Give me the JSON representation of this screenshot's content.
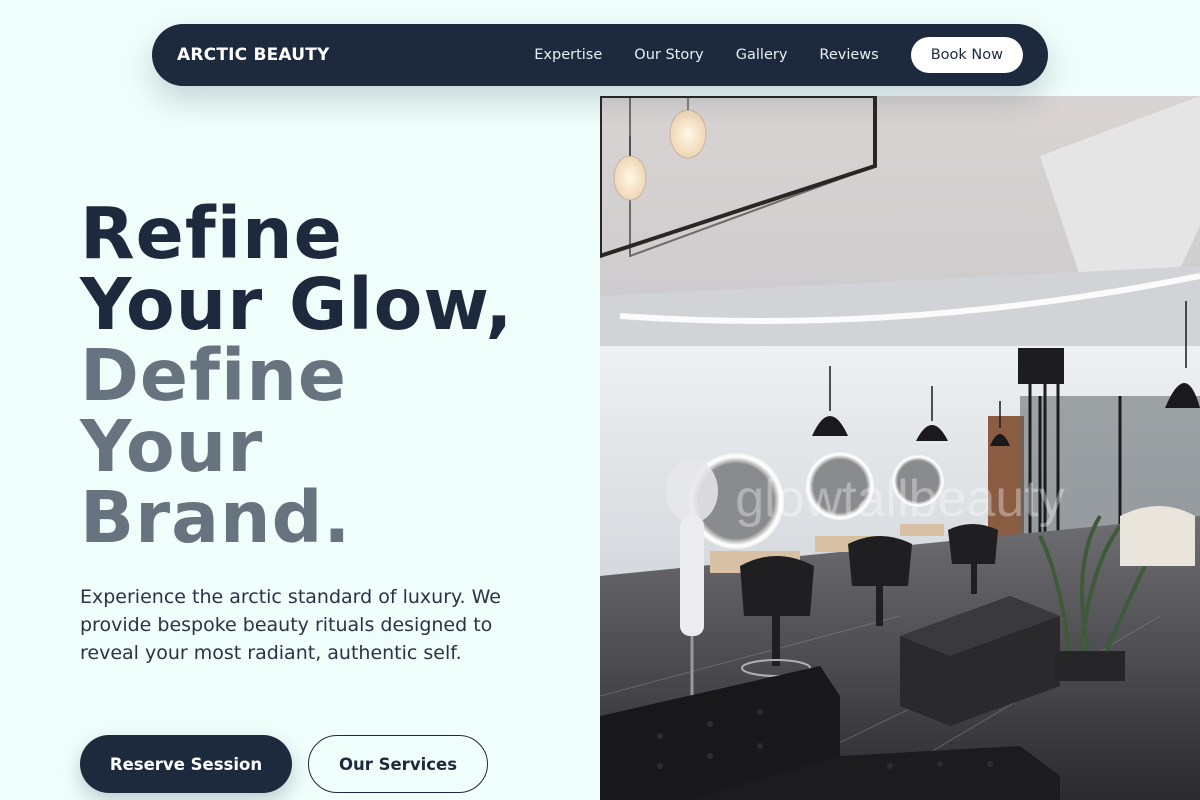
{
  "brand": "ARCTIC BEAUTY",
  "nav": {
    "links": [
      "Expertise",
      "Our Story",
      "Gallery",
      "Reviews"
    ],
    "cta": "Book Now"
  },
  "hero": {
    "title_lines_dark": [
      "Refine",
      "Your Glow,"
    ],
    "title_lines_muted": [
      "Define",
      "Your",
      "Brand."
    ],
    "subtitle": "Experience the arctic standard of luxury. We provide bespoke beauty rituals designed to reveal your most radiant, authentic self.",
    "primary_button": "Reserve Session",
    "secondary_button": "Our Services"
  },
  "image": {
    "subject": "salon-interior-photo",
    "watermark": "glowtallbeauty"
  },
  "colors": {
    "background": "#effdfb",
    "navy": "#1d2a3e",
    "muted_text": "#67737f"
  }
}
